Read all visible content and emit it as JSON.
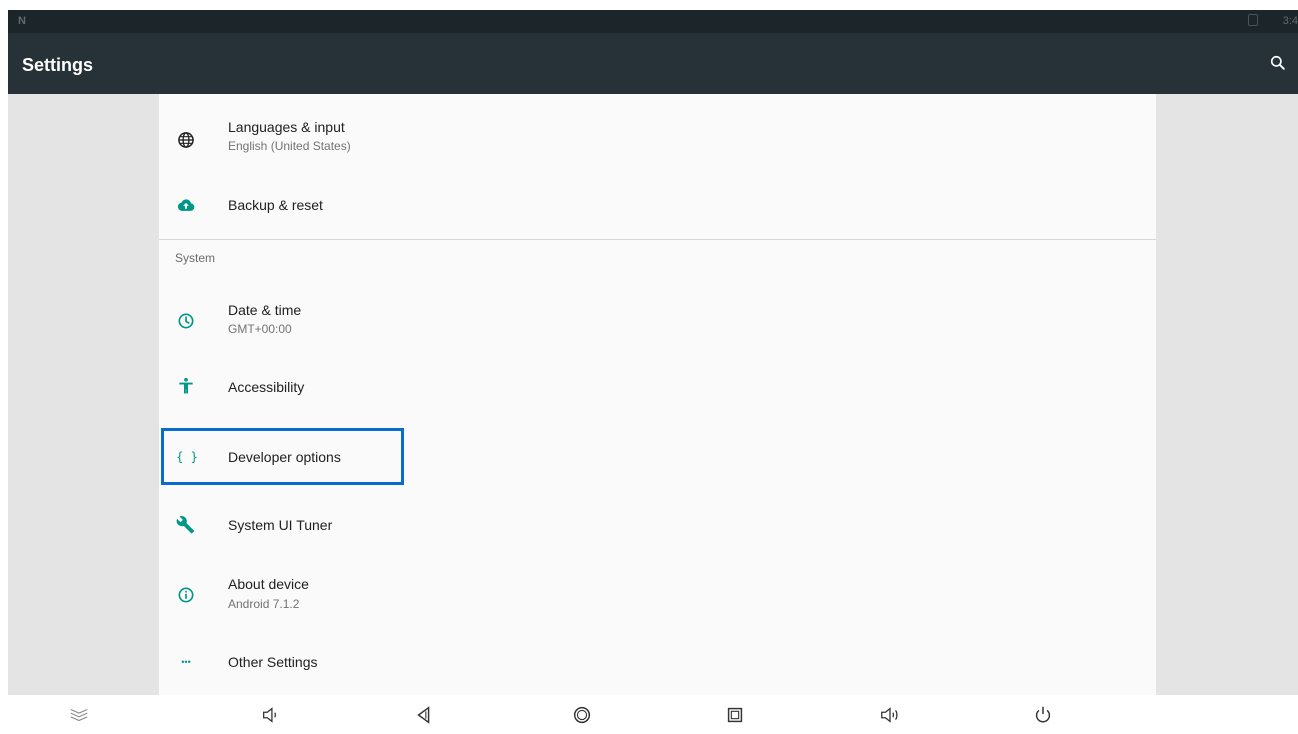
{
  "status_bar": {
    "notification_logo": "N",
    "clock": "3:4"
  },
  "app_bar": {
    "title": "Settings",
    "search_icon": "search-icon"
  },
  "settings": {
    "items_top": [
      {
        "label": "Languages & input",
        "summary": "English (United States)",
        "icon": "globe-icon"
      },
      {
        "label": "Backup & reset",
        "icon": "cloud-upload-icon"
      }
    ],
    "section_label": "System",
    "items_system": [
      {
        "label": "Date & time",
        "summary": "GMT+00:00",
        "icon": "clock-icon"
      },
      {
        "label": "Accessibility",
        "icon": "accessibility-icon"
      },
      {
        "label": "Developer options",
        "icon": "curly-braces-icon"
      },
      {
        "label": "System UI Tuner",
        "icon": "wrench-icon"
      },
      {
        "label": "About device",
        "summary": "Android 7.1.2",
        "icon": "info-icon"
      },
      {
        "label": "Other Settings",
        "icon": "more-dots-icon"
      }
    ],
    "curly_glyph": "{ }",
    "dots_glyph": "•••"
  },
  "colors": {
    "accent": "#009688",
    "app_bar": "#263238",
    "status_bar": "#1c2529",
    "highlight": "#0a6bcf"
  },
  "nav_bar": {
    "icons": [
      "collapse-icon",
      "volume-down-icon",
      "back-icon",
      "home-icon",
      "recents-icon",
      "volume-up-icon",
      "power-icon"
    ]
  }
}
